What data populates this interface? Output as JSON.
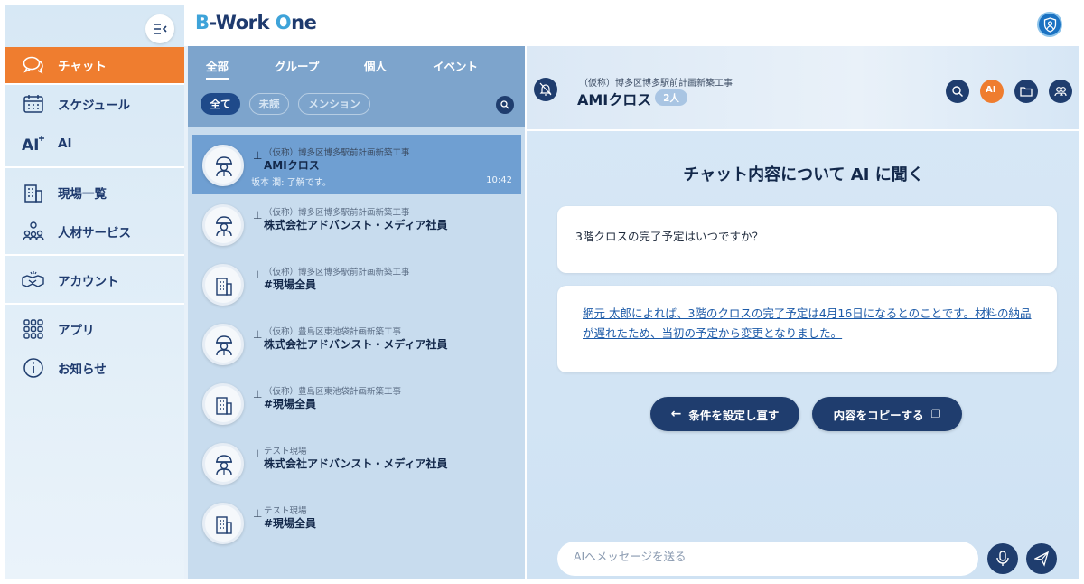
{
  "header": {
    "logo_b": "B",
    "logo_work": "-Work ",
    "logo_o": "O",
    "logo_ne": "ne"
  },
  "sidebar": {
    "items": [
      {
        "label": "チャット",
        "icon": "chat-bubbles-icon",
        "active": true
      },
      {
        "label": "スケジュール",
        "icon": "calendar-icon",
        "active": false
      },
      {
        "label": "AI",
        "icon": "ai-sparkle-icon",
        "active": false
      },
      {
        "label": "現場一覧",
        "icon": "building-icon",
        "active": false
      },
      {
        "label": "人材サービス",
        "icon": "people-group-icon",
        "active": false
      },
      {
        "label": "アカウント",
        "icon": "handshake-icon",
        "active": false
      },
      {
        "label": "アプリ",
        "icon": "app-grid-icon",
        "active": false
      },
      {
        "label": "お知らせ",
        "icon": "info-icon",
        "active": false
      }
    ]
  },
  "chat_list": {
    "tabs": [
      "全部",
      "グループ",
      "個人",
      "イベント"
    ],
    "filters": [
      "全て",
      "未読",
      "メンション"
    ],
    "rows": [
      {
        "sub": "（仮称）博多区博多駅前計画新築工事",
        "title": "AMIクロス",
        "preview": "坂本 潤: 了解です。",
        "time": "10:42",
        "avatar": "worker"
      },
      {
        "sub": "（仮称）博多区博多駅前計画新築工事",
        "title": "株式会社アドバンスト・メディア社員",
        "avatar": "worker"
      },
      {
        "sub": "（仮称）博多区博多駅前計画新築工事",
        "title": "#現場全員",
        "avatar": "building"
      },
      {
        "sub": "（仮称）豊島区東池袋計画新築工事",
        "title": "株式会社アドバンスト・メディア社員",
        "avatar": "worker"
      },
      {
        "sub": "（仮称）豊島区東池袋計画新築工事",
        "title": "#現場全員",
        "avatar": "building"
      },
      {
        "sub": "テスト現場",
        "title": "株式会社アドバンスト・メディア社員",
        "avatar": "worker"
      },
      {
        "sub": "テスト現場",
        "title": "#現場全員",
        "avatar": "building"
      }
    ]
  },
  "main": {
    "project": "（仮称）博多区博多駅前計画新築工事",
    "room": "AMIクロス",
    "member_count": "2人",
    "ai_button": "AI",
    "heading": "チャット内容について AI に聞く",
    "question": "3階クロスの完了予定はいつですか？",
    "answer": "網元 太郎によれば、3階のクロスの完了予定は4月16日になるとのことです。材料の納品が遅れたため、当初の予定から変更となりました。",
    "reset_label": "条件を設定し直す",
    "copy_label": "内容をコピーする",
    "input_placeholder": "AIへメッセージを送る"
  }
}
